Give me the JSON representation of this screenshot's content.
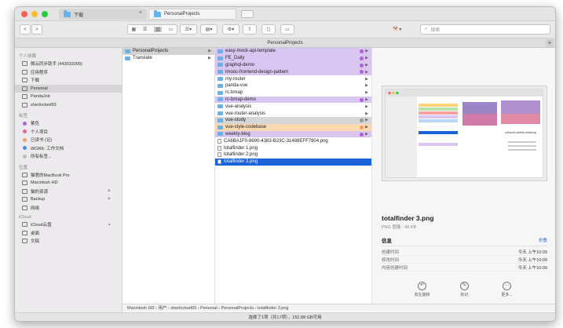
{
  "tabs": [
    {
      "label": "下载",
      "close": "×"
    },
    {
      "label": "PersonalProjects",
      "close": "✕"
    }
  ],
  "toolbar": {
    "back": "<",
    "forward": ">",
    "search_placeholder": "搜索"
  },
  "path_title": "PersonalProjects",
  "plus": "+",
  "sidebar": {
    "favorites_header": "个人收藏",
    "favorites": [
      {
        "label": "微云同步助手 (443033099)",
        "icon": "sync-folder-icon"
      },
      {
        "label": "应用程序",
        "icon": "applications-icon"
      },
      {
        "label": "下载",
        "icon": "downloads-icon"
      },
      {
        "label": "Personal",
        "icon": "folder-icon",
        "active": true
      },
      {
        "label": "PandaJob",
        "icon": "folder-icon"
      },
      {
        "label": "sherlocked93",
        "icon": "home-icon"
      }
    ],
    "tags_header": "标签",
    "tags": [
      {
        "label": "紫色",
        "color": "#b05ee0"
      },
      {
        "label": "个人项目",
        "color": "#f25ca6"
      },
      {
        "label": "已读书 (记)",
        "color": "#f5a05a"
      },
      {
        "label": "WORK: 工作文档",
        "color": "#3d8fe8"
      },
      {
        "label": "所有标签...",
        "color": "#bdbdbd"
      }
    ],
    "locations_header": "位置",
    "locations": [
      {
        "label": "猫君的MacBook Pro",
        "icon": "laptop-icon"
      },
      {
        "label": "Macintosh HD",
        "icon": "disk-icon"
      },
      {
        "label": "猫的资源",
        "icon": "disk-icon",
        "eject": "≜"
      },
      {
        "label": "Backup",
        "icon": "disk-icon",
        "eject": "≜"
      },
      {
        "label": "网络",
        "icon": "network-icon"
      }
    ],
    "icloud_header": "iCloud",
    "icloud": [
      {
        "label": "iCloud云盘",
        "icon": "cloud-icon",
        "progress_icon": "◔"
      },
      {
        "label": "桌面",
        "icon": "desktop-icon"
      },
      {
        "label": "文稿",
        "icon": "document-icon"
      }
    ]
  },
  "column1": [
    {
      "label": "PersonalProjects",
      "arrow": "▶"
    },
    {
      "label": "Translate",
      "arrow": "▶"
    }
  ],
  "column2": [
    {
      "label": "easy-mock-api-template",
      "type": "folder",
      "bg": "#d9c6f0",
      "tag": "#b05ee0"
    },
    {
      "label": "FE_Daily",
      "type": "folder",
      "bg": "#d9c6f0",
      "tag": "#b05ee0"
    },
    {
      "label": "graphql-demo",
      "type": "folder",
      "bg": "#d9c6f0",
      "tag": "#b05ee0"
    },
    {
      "label": "imooc-frontend-design-pattern",
      "type": "folder",
      "bg": "#d9c6f0",
      "tag": "#b05ee0"
    },
    {
      "label": "my-router",
      "type": "folder"
    },
    {
      "label": "panda-vue",
      "type": "folder"
    },
    {
      "label": "rc-bmap",
      "type": "folder"
    },
    {
      "label": "rc-bmap-demo",
      "type": "folder",
      "bg": "#d9c6f0",
      "tag": "#b05ee0"
    },
    {
      "label": "vue-analysis",
      "type": "folder"
    },
    {
      "label": "vue-router-analysis",
      "type": "folder"
    },
    {
      "label": "vue-study",
      "type": "folder",
      "bg": "#d6d6d6",
      "tag": "#9a9a9a"
    },
    {
      "label": "vue-style-codebase",
      "type": "folder",
      "bg": "#fbd9b0",
      "tag": "#f5a05a"
    },
    {
      "label": "weekly-blog",
      "type": "folder",
      "bg": "#d9c6f0",
      "tag": "#b05ee0"
    },
    {
      "label": "CA6BA1F0-8690-4383-B23C-31488EFF7804.png",
      "type": "file"
    },
    {
      "label": "totalfinder 1.png",
      "type": "file"
    },
    {
      "label": "totalfinder 2.png",
      "type": "file"
    },
    {
      "label": "totalfinder 3.png",
      "type": "file",
      "selected": true
    }
  ],
  "preview": {
    "thumb_caption": "colored-labels-desktop",
    "name": "totalfinder 3.png",
    "meta": "PNG 图像 - 90 KB",
    "info_label": "信息",
    "more_label": "折叠",
    "rows": [
      {
        "k": "创建时间",
        "v": "今天 上午10:09"
      },
      {
        "k": "修改时间",
        "v": "今天 上午10:09"
      },
      {
        "k": "内容创建时间",
        "v": "今天 上午10:09"
      }
    ],
    "actions": [
      {
        "label": "向左旋转",
        "icon": "↶"
      },
      {
        "label": "标记",
        "icon": "✎"
      },
      {
        "label": "更多...",
        "icon": "⋯"
      }
    ]
  },
  "bottom_path": [
    "Macintosh HD",
    "用户",
    "sherlocked93",
    "Personal",
    "PersonalProjects",
    "totalfinder 3.png"
  ],
  "status": "选择了1项（共17项），152.88 GB可用"
}
